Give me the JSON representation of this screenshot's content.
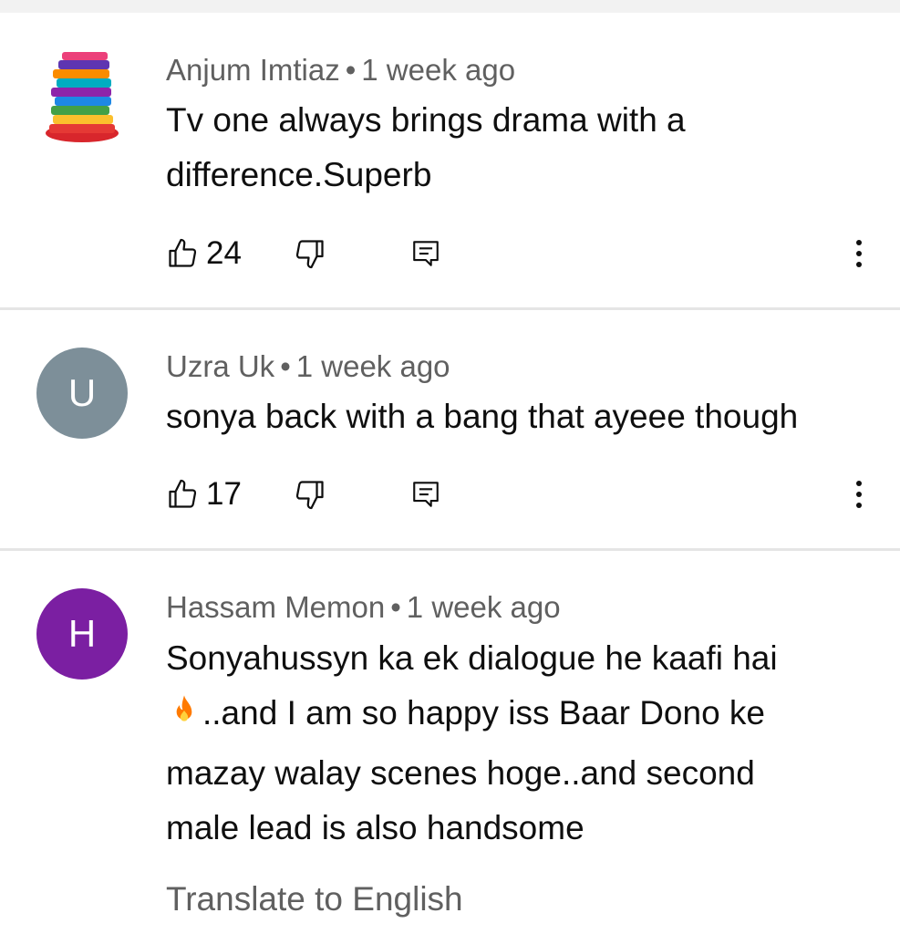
{
  "comments": [
    {
      "author": "Anjum Imtiaz",
      "time": "1 week ago",
      "avatar_type": "books-image",
      "text_lines": [
        "Tv one always brings drama with a",
        "difference.Superb"
      ],
      "likes": "24"
    },
    {
      "author": "Uzra Uk",
      "time": "1 week ago",
      "avatar_initial": "U",
      "avatar_color": "#7d8f99",
      "text_lines": [
        "sonya back with a bang that ayeee though"
      ],
      "likes": "17"
    },
    {
      "author": "Hassam Memon",
      "time": "1 week ago",
      "avatar_initial": "H",
      "avatar_color": "#7b1fa2",
      "text_line_1": "Sonyahussyn ka ek dialogue he kaafi hai",
      "text_line_2_emoji": "fire-emoji",
      "text_line_2": "..and I am so happy iss Baar Dono ke",
      "text_line_3": "mazay walay scenes hoge..and second",
      "text_line_4": "male lead is also handsome"
    }
  ],
  "separator": "•",
  "translate_label": "Translate to English",
  "icons": {
    "like": "thumbs-up-icon",
    "dislike": "thumbs-down-icon",
    "reply": "reply-comment-icon",
    "more": "more-vertical-icon"
  }
}
